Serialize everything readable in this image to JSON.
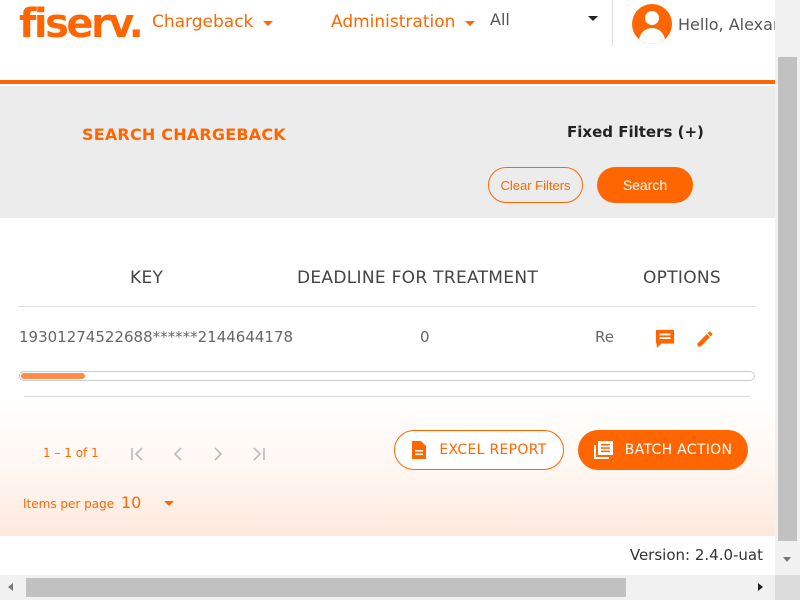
{
  "header": {
    "logo_text": "fiserv.",
    "nav": {
      "chargeback_label": "Chargeback",
      "administration_label": "Administration"
    },
    "scope_select": {
      "selected": "All"
    },
    "greeting": "Hello, Alexan"
  },
  "search": {
    "title": "SEARCH CHARGEBACK",
    "fixed_filters_label": "Fixed Filters (+)",
    "clear_filters_label": "Clear Filters",
    "search_label": "Search"
  },
  "table": {
    "columns": {
      "key": "KEY",
      "deadline": "DEADLINE FOR TREATMENT",
      "options": "OPTIONS"
    },
    "rows": [
      {
        "key": "19301274522688******2144644178",
        "deadline": "0",
        "clipped": "Re"
      }
    ]
  },
  "paginator": {
    "range_label": "1 – 1 of 1",
    "items_per_page_label": "Items per page",
    "items_per_page_value": "10",
    "excel_report_label": "EXCEL REPORT",
    "batch_action_label": "BATCH ACTION"
  },
  "footer": {
    "version": "Version: 2.4.0-uat"
  },
  "colors": {
    "brand": "#ff6600",
    "band_bg": "#ececec"
  },
  "icons": [
    "user-avatar-icon",
    "comment-icon",
    "edit-pencil-icon",
    "first-page-icon",
    "previous-page-icon",
    "next-page-icon",
    "last-page-icon",
    "document-icon",
    "batch-list-icon"
  ]
}
